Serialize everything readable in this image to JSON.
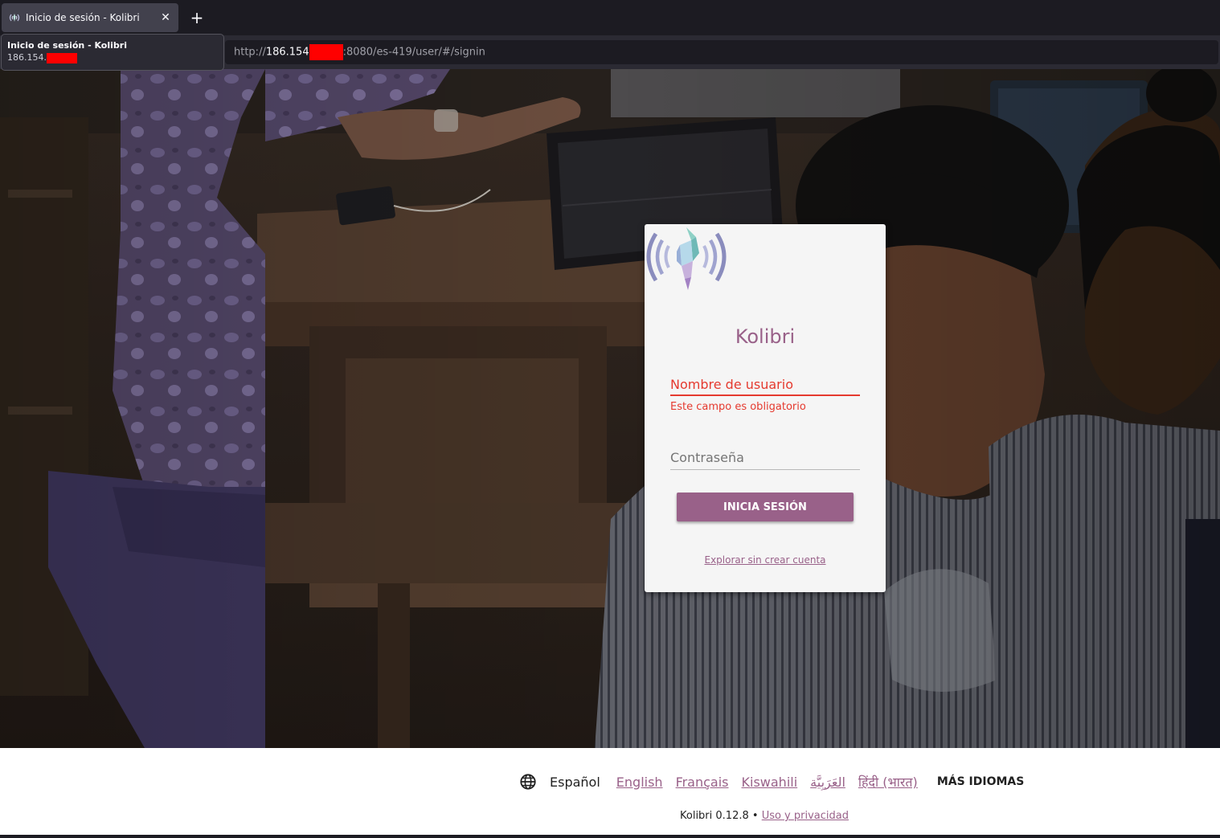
{
  "browser": {
    "tab": {
      "title": "Inicio de sesión - Kolibri",
      "close_glyph": "✕",
      "favicon": "kolibri-icon"
    },
    "new_tab_glyph": "+",
    "tooltip": {
      "title": "Inicio de sesión - Kolibri",
      "url": "186.154."
    },
    "url": {
      "scheme": "http://",
      "host": "186.154",
      "rest": ":8080/es-419/user/#/signin"
    }
  },
  "login": {
    "app_name": "Kolibri",
    "username_label": "Nombre de usuario",
    "username_error": "Este campo es obligatorio",
    "password_label": "Contraseña",
    "signin_button": "INICIA SESIÓN",
    "guest_link": "Explorar sin crear cuenta"
  },
  "footer": {
    "current_language": "Español",
    "languages": [
      "English",
      "Français",
      "Kiswahili",
      "العَرَبِيَّة",
      "हिंदी (भारत)"
    ],
    "more_languages": "MÁS IDIOMAS",
    "version": "Kolibri 0.12.8 •",
    "privacy_link": "Uso y privacidad"
  },
  "colors": {
    "accent": "#996189",
    "error": "#e53a2f",
    "redaction": "#ff0000"
  }
}
